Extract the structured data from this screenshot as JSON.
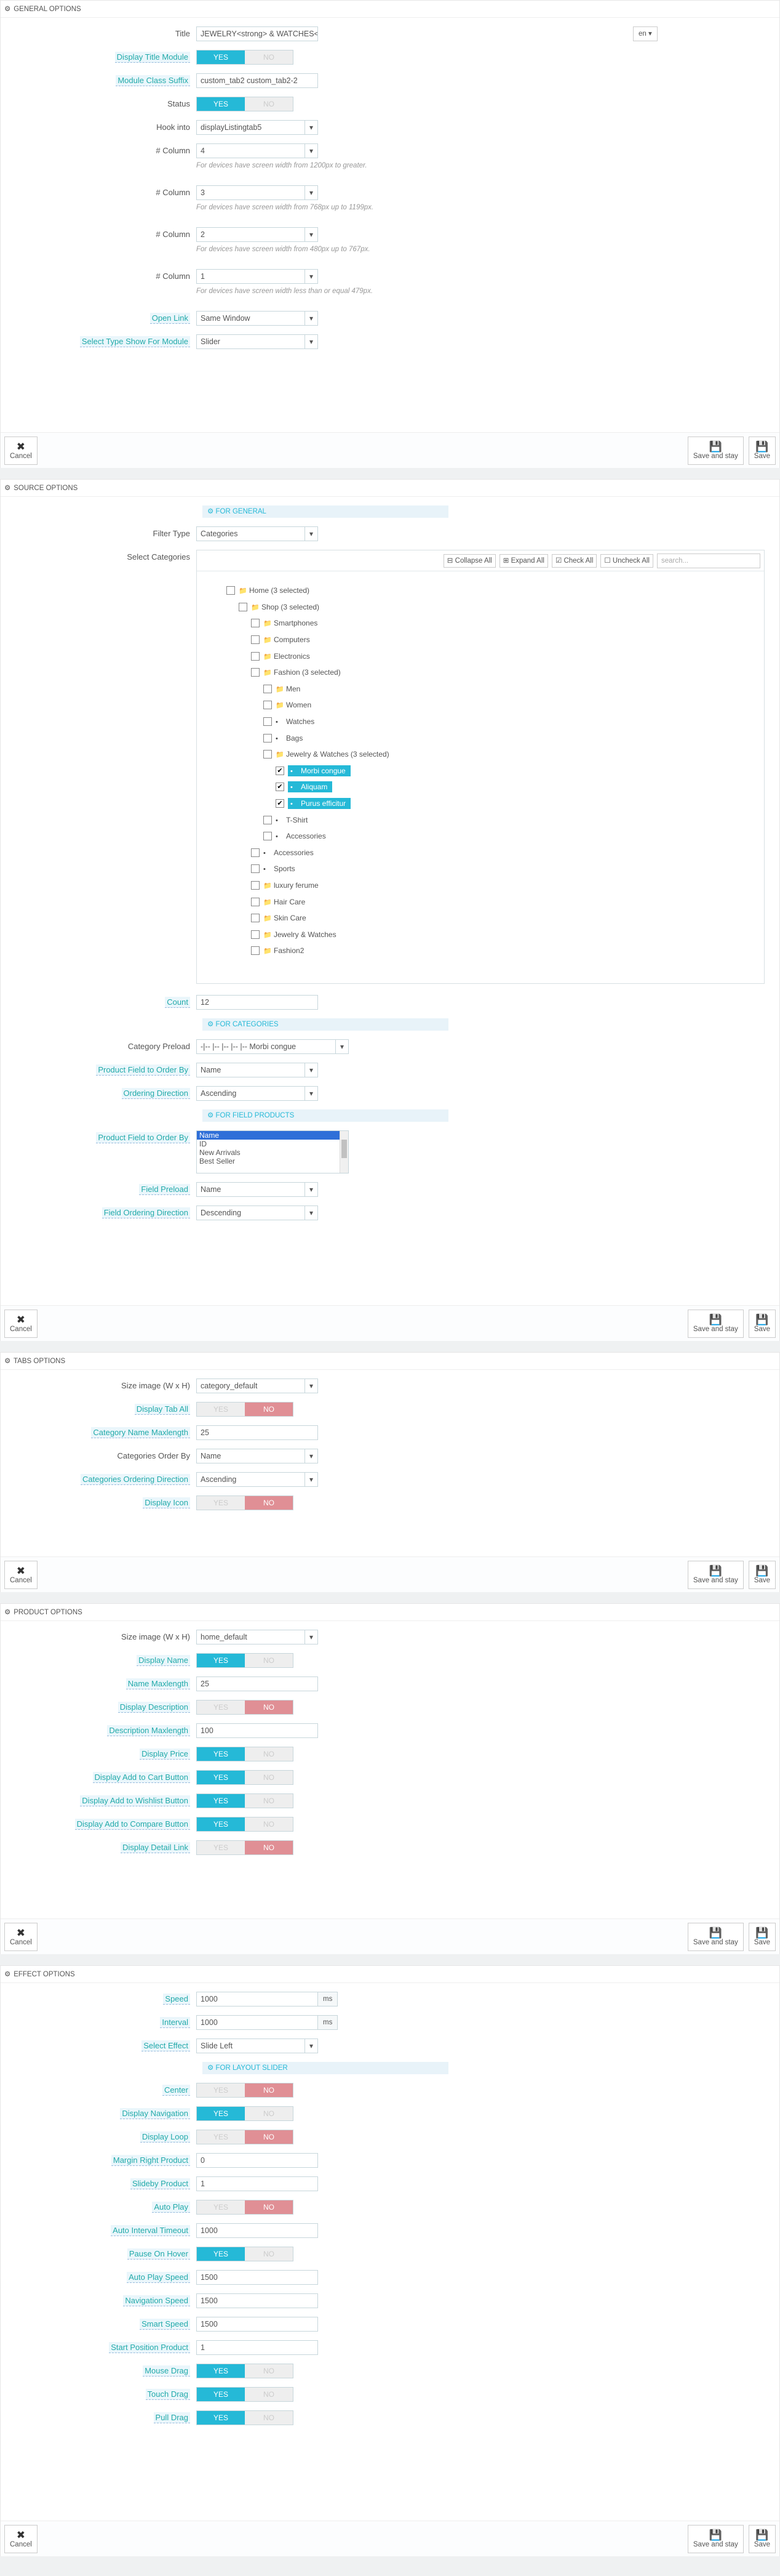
{
  "lang": "en",
  "buttons": {
    "cancel": "Cancel",
    "save_stay": "Save and stay",
    "save": "Save"
  },
  "icons": {
    "gear": "gear-icon",
    "cancel": "close-icon",
    "save": "floppy-icon"
  },
  "colors": {
    "accent": "#25b9d7",
    "no_active": "#e08f95"
  },
  "switch": {
    "yes": "YES",
    "no": "NO"
  },
  "general": {
    "title": "GENERAL OPTIONS",
    "title_label": "Title",
    "title_value": "JEWELRY<strong> & WATCHES</strong>",
    "display_title_label": "Display Title Module",
    "display_title": "yes",
    "class_suffix_label": "Module Class Suffix",
    "class_suffix_value": "custom_tab2 custom_tab2-2",
    "status_label": "Status",
    "status": "yes",
    "hook_label": "Hook into",
    "hook_value": "displayListingtab5",
    "columns": [
      {
        "label": "# Column",
        "value": "4",
        "help": "For devices have screen width from 1200px to greater."
      },
      {
        "label": "# Column",
        "value": "3",
        "help": "For devices have screen width from 768px up to 1199px."
      },
      {
        "label": "# Column",
        "value": "2",
        "help": "For devices have screen width from 480px up to 767px."
      },
      {
        "label": "# Column",
        "value": "1",
        "help": "For devices have screen width less than or equal 479px."
      }
    ],
    "open_link_label": "Open Link",
    "open_link_value": "Same Window",
    "type_show_label": "Select Type Show For Module",
    "type_show_value": "Slider"
  },
  "source": {
    "title": "SOURCE OPTIONS",
    "for_general": "FOR GENERAL",
    "filter_type_label": "Filter Type",
    "filter_type_value": "Categories",
    "select_categories_label": "Select Categories",
    "tree_tools": {
      "collapse": "Collapse All",
      "expand": "Expand All",
      "check": "Check All",
      "uncheck": "Uncheck All",
      "search": "search..."
    },
    "tree": [
      {
        "label": "Home (3 selected)",
        "level": 0,
        "folder": true,
        "checked": false
      },
      {
        "label": "Shop (3 selected)",
        "level": 1,
        "folder": true,
        "checked": false
      },
      {
        "label": "Smartphones",
        "level": 2,
        "folder": true,
        "checked": false
      },
      {
        "label": "Computers",
        "level": 2,
        "folder": true,
        "checked": false
      },
      {
        "label": "Electronics",
        "level": 2,
        "folder": true,
        "checked": false
      },
      {
        "label": "Fashion (3 selected)",
        "level": 2,
        "folder": true,
        "checked": false
      },
      {
        "label": "Men",
        "level": 3,
        "folder": true,
        "checked": false
      },
      {
        "label": "Women",
        "level": 3,
        "folder": true,
        "checked": false
      },
      {
        "label": "Watches",
        "level": 3,
        "folder": false,
        "checked": false
      },
      {
        "label": "Bags",
        "level": 3,
        "folder": false,
        "checked": false
      },
      {
        "label": "Jewelry & Watches (3 selected)",
        "level": 3,
        "folder": true,
        "checked": false
      },
      {
        "label": "Morbi congue",
        "level": 4,
        "folder": false,
        "checked": true
      },
      {
        "label": "Aliquam",
        "level": 4,
        "folder": false,
        "checked": true
      },
      {
        "label": "Purus efficitur",
        "level": 4,
        "folder": false,
        "checked": true
      },
      {
        "label": "T-Shirt",
        "level": 3,
        "folder": false,
        "checked": false
      },
      {
        "label": "Accessories",
        "level": 3,
        "folder": false,
        "checked": false
      },
      {
        "label": "Accessories",
        "level": 2,
        "folder": false,
        "checked": false
      },
      {
        "label": "Sports",
        "level": 2,
        "folder": false,
        "checked": false
      },
      {
        "label": "luxury ferume",
        "level": 2,
        "folder": true,
        "checked": false
      },
      {
        "label": "Hair Care",
        "level": 2,
        "folder": true,
        "checked": false
      },
      {
        "label": "Skin Care",
        "level": 2,
        "folder": true,
        "checked": false
      },
      {
        "label": "Jewelry & Watches",
        "level": 2,
        "folder": true,
        "checked": false
      },
      {
        "label": "Fashion2",
        "level": 2,
        "folder": true,
        "checked": false
      }
    ],
    "count_label": "Count",
    "count_value": "12",
    "for_categories": "FOR CATEGORIES",
    "category_preload_label": "Category Preload",
    "category_preload_value": "-|-- |-- |-- |-- |-- Morbi congue",
    "pf_order_label": "Product Field to Order By",
    "pf_order_value": "Name",
    "order_dir_label": "Ordering Direction",
    "order_dir_value": "Ascending",
    "for_field": "FOR FIELD PRODUCTS",
    "pf_order2_label": "Product Field to Order By",
    "pf_list": [
      "Name",
      "ID",
      "New Arrivals",
      "Best Seller"
    ],
    "field_preload_label": "Field Preload",
    "field_preload_value": "Name",
    "field_dir_label": "Field Ordering Direction",
    "field_dir_value": "Descending"
  },
  "tabs": {
    "title": "TABS OPTIONS",
    "size_label": "Size image (W x H)",
    "size_value": "category_default",
    "display_tab_all_label": "Display Tab All",
    "display_tab_all": "no",
    "cat_maxlen_label": "Category Name Maxlength",
    "cat_maxlen_value": "25",
    "cat_order_label": "Categories Order By",
    "cat_order_value": "Name",
    "cat_dir_label": "Categories Ordering Direction",
    "cat_dir_value": "Ascending",
    "display_icon_label": "Display Icon",
    "display_icon": "no"
  },
  "product": {
    "title": "PRODUCT OPTIONS",
    "size_label": "Size image (W x H)",
    "size_value": "home_default",
    "display_name_label": "Display Name",
    "display_name": "yes",
    "name_maxlen_label": "Name Maxlength",
    "name_maxlen_value": "25",
    "display_desc_label": "Display Description",
    "display_desc": "no",
    "desc_maxlen_label": "Description Maxlength",
    "desc_maxlen_value": "100",
    "display_price_label": "Display Price",
    "display_price": "yes",
    "add_cart_label": "Display Add to Cart Button",
    "add_cart": "yes",
    "wishlist_label": "Display Add to Wishlist Button",
    "wishlist": "yes",
    "compare_label": "Display Add to Compare Button",
    "compare": "yes",
    "detail_link_label": "Display Detail Link",
    "detail_link": "no"
  },
  "effect": {
    "title": "EFFECT OPTIONS",
    "speed_label": "Speed",
    "speed_value": "1000",
    "speed_unit": "ms",
    "interval_label": "Interval",
    "interval_value": "1000",
    "interval_unit": "ms",
    "select_effect_label": "Select Effect",
    "select_effect_value": "Slide Left",
    "for_layout": "FOR LAYOUT SLIDER",
    "center_label": "Center",
    "center": "no",
    "nav_label": "Display Navigation",
    "nav": "yes",
    "loop_label": "Display Loop",
    "loop": "no",
    "margin_label": "Margin Right Product",
    "margin_value": "0",
    "slideby_label": "Slideby Product",
    "slideby_value": "1",
    "autoplay_label": "Auto Play",
    "autoplay": "no",
    "ai_timeout_label": "Auto Interval Timeout",
    "ai_timeout_value": "1000",
    "pause_label": "Pause On Hover",
    "pause": "yes",
    "ap_speed_label": "Auto Play Speed",
    "ap_speed_value": "1500",
    "nav_speed_label": "Navigation Speed",
    "nav_speed_value": "1500",
    "smart_speed_label": "Smart Speed",
    "smart_speed_value": "1500",
    "start_pos_label": "Start Position Product",
    "start_pos_value": "1",
    "mouse_label": "Mouse Drag",
    "mouse": "yes",
    "touch_label": "Touch Drag",
    "touch": "yes",
    "pull_label": "Pull Drag",
    "pull": "yes"
  }
}
